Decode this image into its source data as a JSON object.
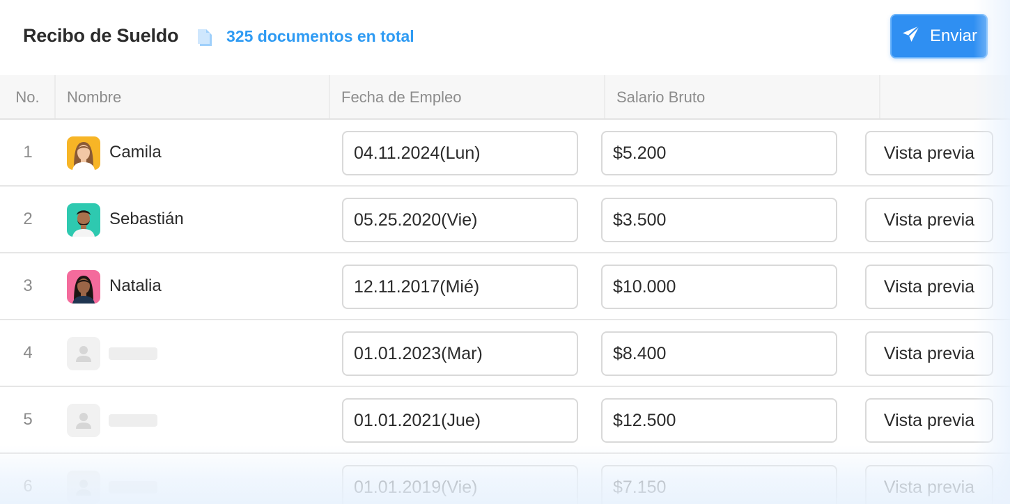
{
  "header": {
    "title": "Recibo de Sueldo",
    "doc_count": "325 documentos en total",
    "doc_icon": "document-stack-icon",
    "send_label": "Enviar",
    "send_icon": "paper-plane-icon"
  },
  "table": {
    "columns": [
      "No.",
      "Nombre",
      "Fecha de Empleo",
      "Salario Bruto",
      ""
    ],
    "rows": [
      {
        "no": "1",
        "name": "Camila",
        "date": "04.11.2024(Lun)",
        "salary": "$5.200",
        "action": "Vista previa",
        "avatar": "woman-light"
      },
      {
        "no": "2",
        "name": "Sebastián",
        "date": "05.25.2020(Vie)",
        "salary": "$3.500",
        "action": "Vista previa",
        "avatar": "man-beard"
      },
      {
        "no": "3",
        "name": "Natalia",
        "date": "12.11.2017(Mié)",
        "salary": "$10.000",
        "action": "Vista previa",
        "avatar": "woman-dark"
      },
      {
        "no": "4",
        "name": "",
        "date": "01.01.2023(Mar)",
        "salary": "$8.400",
        "action": "Vista previa",
        "avatar": "placeholder"
      },
      {
        "no": "5",
        "name": "",
        "date": "01.01.2021(Jue)",
        "salary": "$12.500",
        "action": "Vista previa",
        "avatar": "placeholder"
      },
      {
        "no": "6",
        "name": "",
        "date": "01.01.2019(Vie)",
        "salary": "$7.150",
        "action": "Vista previa",
        "avatar": "placeholder"
      }
    ]
  },
  "colors": {
    "accent": "#2f8ff2",
    "accent_text": "#2f9bf3",
    "border": "#d9d9d9",
    "muted_text": "#8c8c8c",
    "header_bg": "#f7f7f7"
  }
}
